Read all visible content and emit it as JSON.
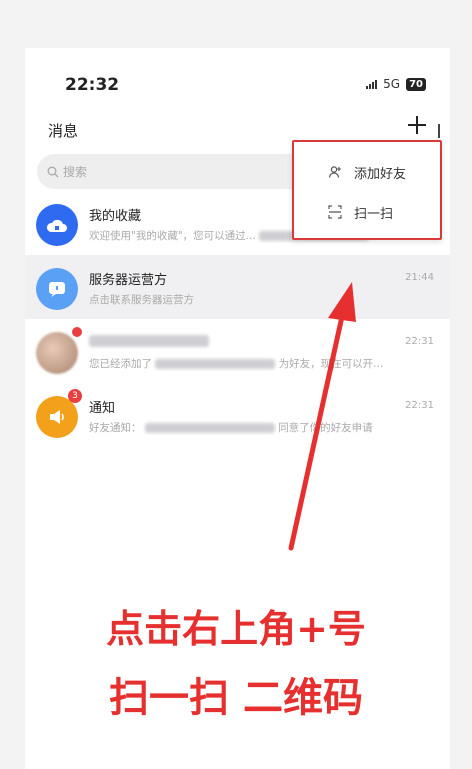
{
  "status_bar": {
    "time": "22:32",
    "network": "5G",
    "battery": "70"
  },
  "header": {
    "title": "消息",
    "plus_icon": "plus-icon"
  },
  "search": {
    "placeholder": "搜索"
  },
  "popup_menu": {
    "items": [
      {
        "icon": "add-friend-icon",
        "label": "添加好友"
      },
      {
        "icon": "scan-icon",
        "label": "扫一扫"
      }
    ]
  },
  "conversations": [
    {
      "name": "我的收藏",
      "preview": "欢迎使用\"我的收藏\"，您可以通过...",
      "time": "",
      "avatar_color": "#2f6bf0",
      "icon": "cloud-icon",
      "badge": ""
    },
    {
      "name": "服务器运营方",
      "preview": "点击联系服务器运营方",
      "time": "21:44",
      "avatar_color": "#5aa0f5",
      "icon": "chat-icon",
      "badge": ""
    },
    {
      "name": "",
      "preview": "您已经添加了",
      "preview_tail": "为好友，现在可以开...",
      "time": "22:31",
      "avatar_color": "#c9a48f",
      "icon": "",
      "badge": ""
    },
    {
      "name": "通知",
      "preview": "好友通知：",
      "preview_tail": "同意了你的好友申请",
      "time": "22:31",
      "avatar_color": "#f3a01a",
      "icon": "speaker-icon",
      "badge": "3"
    }
  ],
  "annotation": {
    "line1": "点击右上角+号",
    "line2": "扫一扫 二维码",
    "color": "#e63030"
  }
}
